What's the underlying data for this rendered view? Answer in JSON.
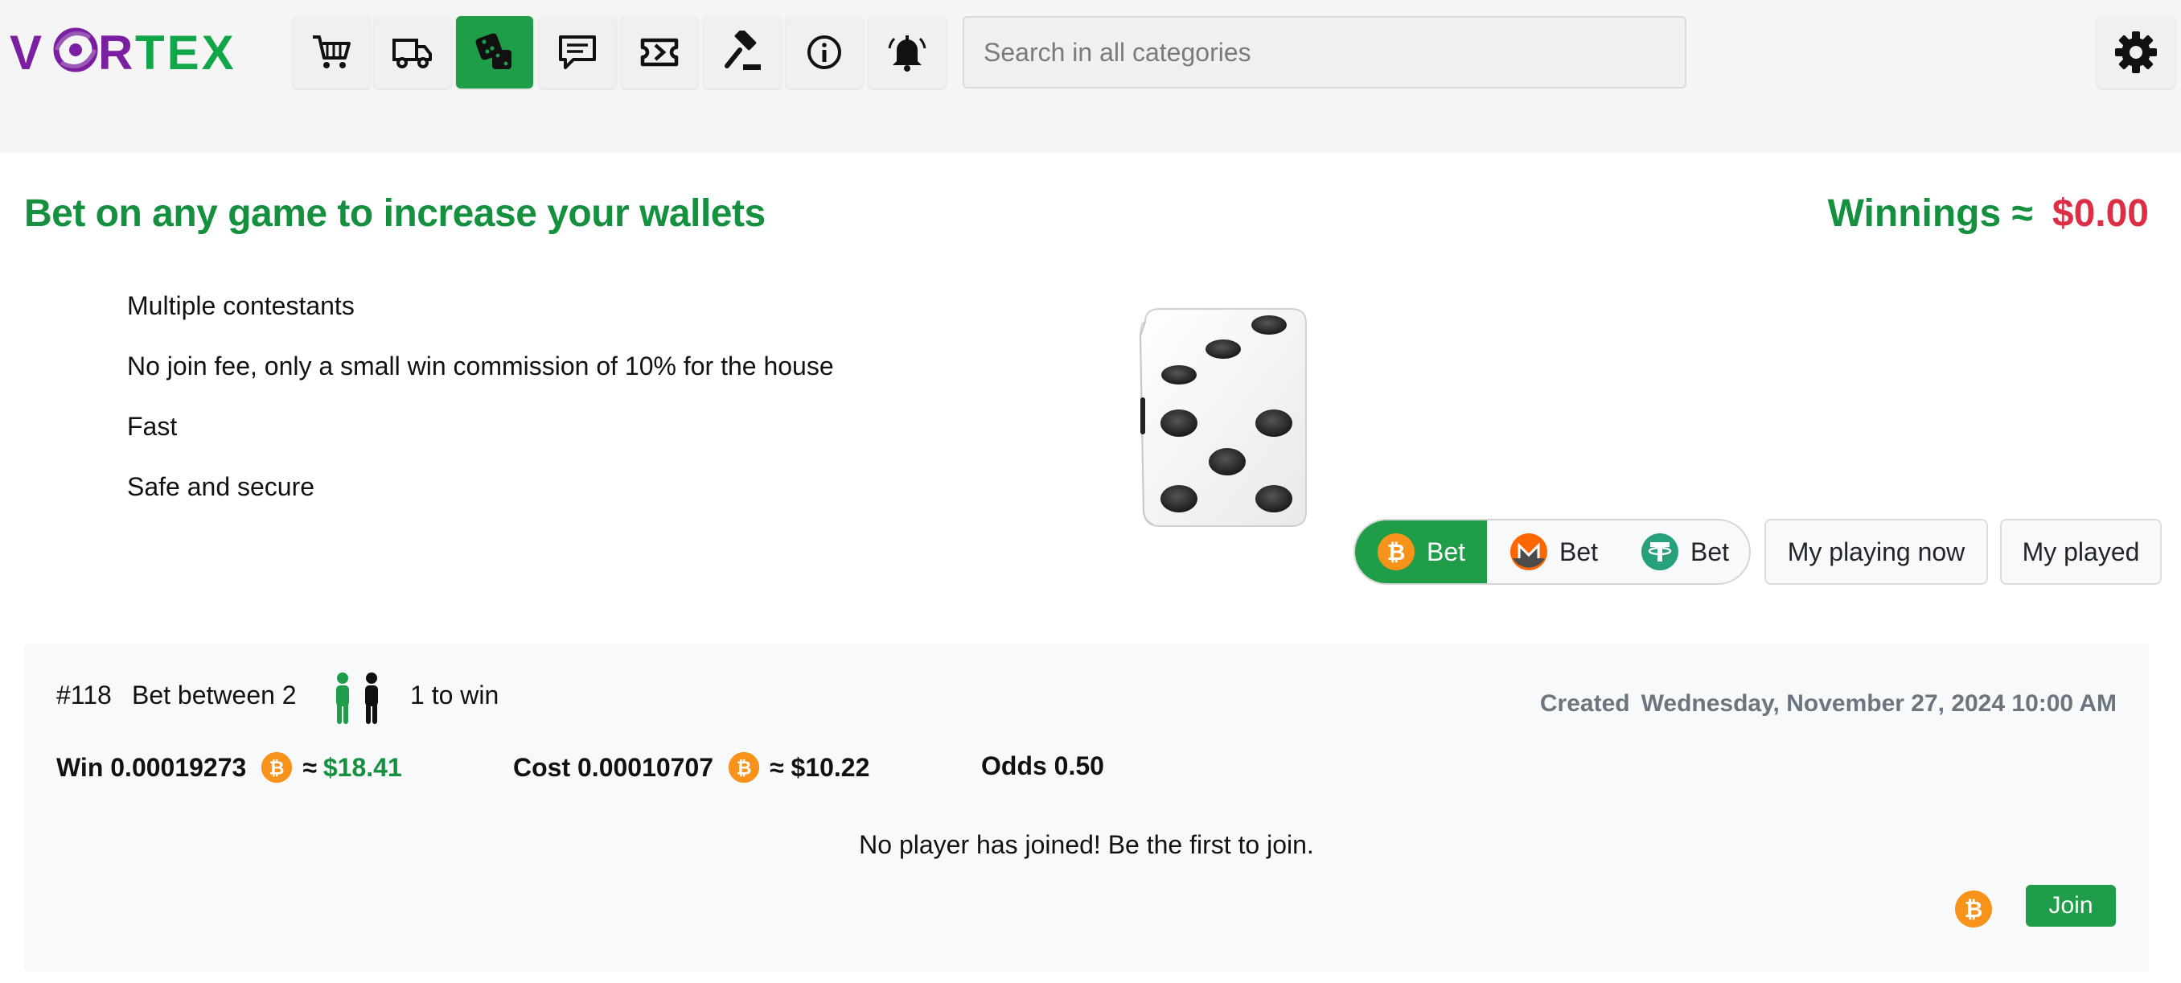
{
  "header": {
    "logo_text_a": "V",
    "logo_text_b": "R",
    "logo_text_c": "TEX",
    "nav": [
      {
        "icon": "cart-icon"
      },
      {
        "icon": "delivery-truck-icon"
      },
      {
        "icon": "dice-icon",
        "active": true
      },
      {
        "icon": "chat-icon"
      },
      {
        "icon": "ticket-icon"
      },
      {
        "icon": "auction-gavel-icon"
      },
      {
        "icon": "info-icon"
      },
      {
        "icon": "notification-bell-icon"
      }
    ],
    "search_placeholder": "Search in all categories",
    "settings_icon": "gear-icon"
  },
  "main": {
    "headline": "Bet on any game to increase your wallets",
    "winnings_label": "Winnings ≈",
    "winnings_value": "$0.00",
    "features": [
      "Multiple contestants",
      "No join fee, only a small win commission of 10% for the house",
      "Fast",
      "Safe and secure"
    ],
    "bet_options": [
      {
        "coin": "bitcoin",
        "label": "Bet",
        "active": true
      },
      {
        "coin": "monero",
        "label": "Bet",
        "active": false
      },
      {
        "coin": "tether",
        "label": "Bet",
        "active": false
      }
    ],
    "my_playing_now": "My playing now",
    "my_played": "My played"
  },
  "game": {
    "id": "#118",
    "between_label": "Bet between 2",
    "to_win": "1 to win",
    "created_label": "Created",
    "created_date": "Wednesday, November 27, 2024 10:00 AM",
    "win_label": "Win 0.00019273",
    "win_approx": "≈",
    "win_usd": "$18.41",
    "cost_label": "Cost 0.00010707",
    "cost_approx": "≈ $10.22",
    "odds": "Odds 0.50",
    "empty_message": "No player has joined! Be the first to join.",
    "join_label": "Join"
  },
  "colors": {
    "brand_green": "#1f9d49",
    "headline_green": "#15903f",
    "winnings_red": "#dc2f45",
    "logo_purple": "#7b1fa2",
    "bitcoin_orange": "#f7931a",
    "monero_orange": "#ff6600",
    "tether_teal": "#26a17b"
  }
}
